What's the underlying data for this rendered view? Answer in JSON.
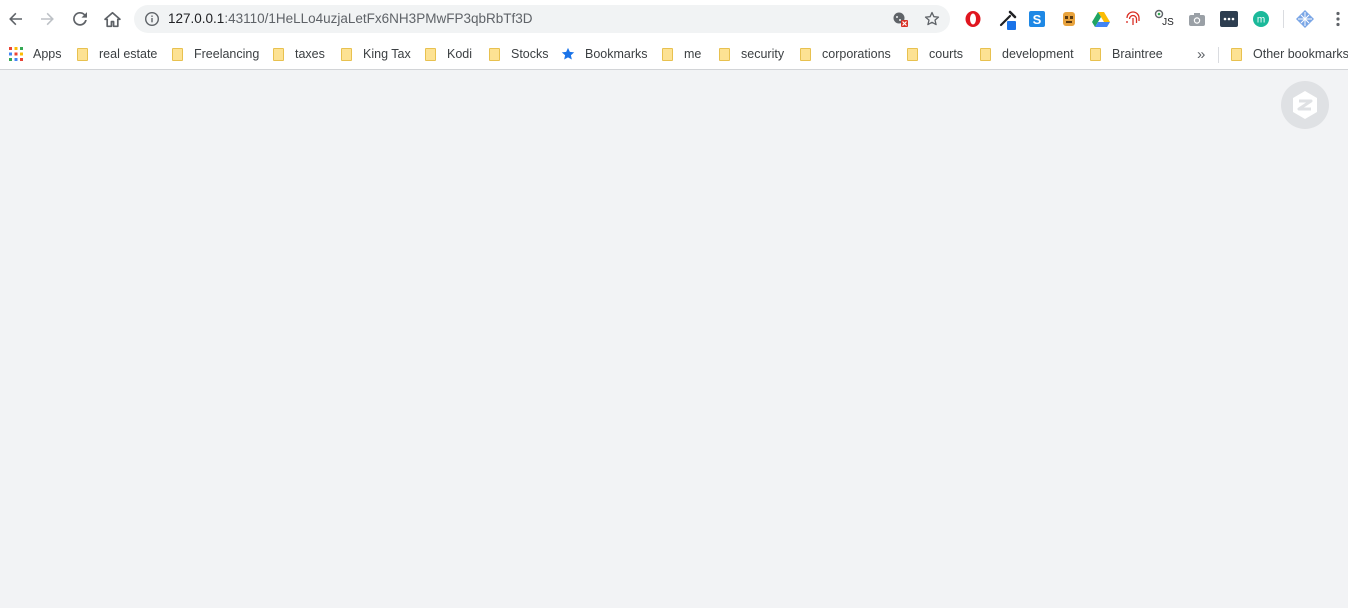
{
  "browser": {
    "url_host": "127.0.0.1",
    "url_rest": ":43110/1HeLLo4uzjaLetFx6NH3PMwFP3qbRbTf3D"
  },
  "bookmarks": {
    "apps_label": "Apps",
    "items": [
      {
        "label": "real estate",
        "icon": "folder-icon"
      },
      {
        "label": "Freelancing",
        "icon": "folder-icon"
      },
      {
        "label": "taxes",
        "icon": "folder-icon"
      },
      {
        "label": "King Tax",
        "icon": "folder-icon"
      },
      {
        "label": "Kodi",
        "icon": "folder-icon"
      },
      {
        "label": "Stocks",
        "icon": "folder-icon"
      },
      {
        "label": "Bookmarks",
        "icon": "star-icon"
      },
      {
        "label": "me",
        "icon": "folder-icon"
      },
      {
        "label": "security",
        "icon": "folder-icon"
      },
      {
        "label": "corporations",
        "icon": "folder-icon"
      },
      {
        "label": "courts",
        "icon": "folder-icon"
      },
      {
        "label": "development",
        "icon": "folder-icon"
      },
      {
        "label": "Braintree",
        "icon": "folder-icon"
      }
    ],
    "overflow_label": "»",
    "other_label": "Other bookmarks"
  },
  "extensions": [
    "opera-icon",
    "eyedropper-icon",
    "s-extension-icon",
    "robot-icon",
    "google-drive-icon",
    "fingerprint-icon",
    "js-icon",
    "camera-icon",
    "terminal-icon",
    "m-extension-icon",
    "zeronet-extension-icon"
  ],
  "colors": {
    "content_bg": "#f2f3f5",
    "bookmark_star": "#1a73e8",
    "folder": "#fde293"
  }
}
